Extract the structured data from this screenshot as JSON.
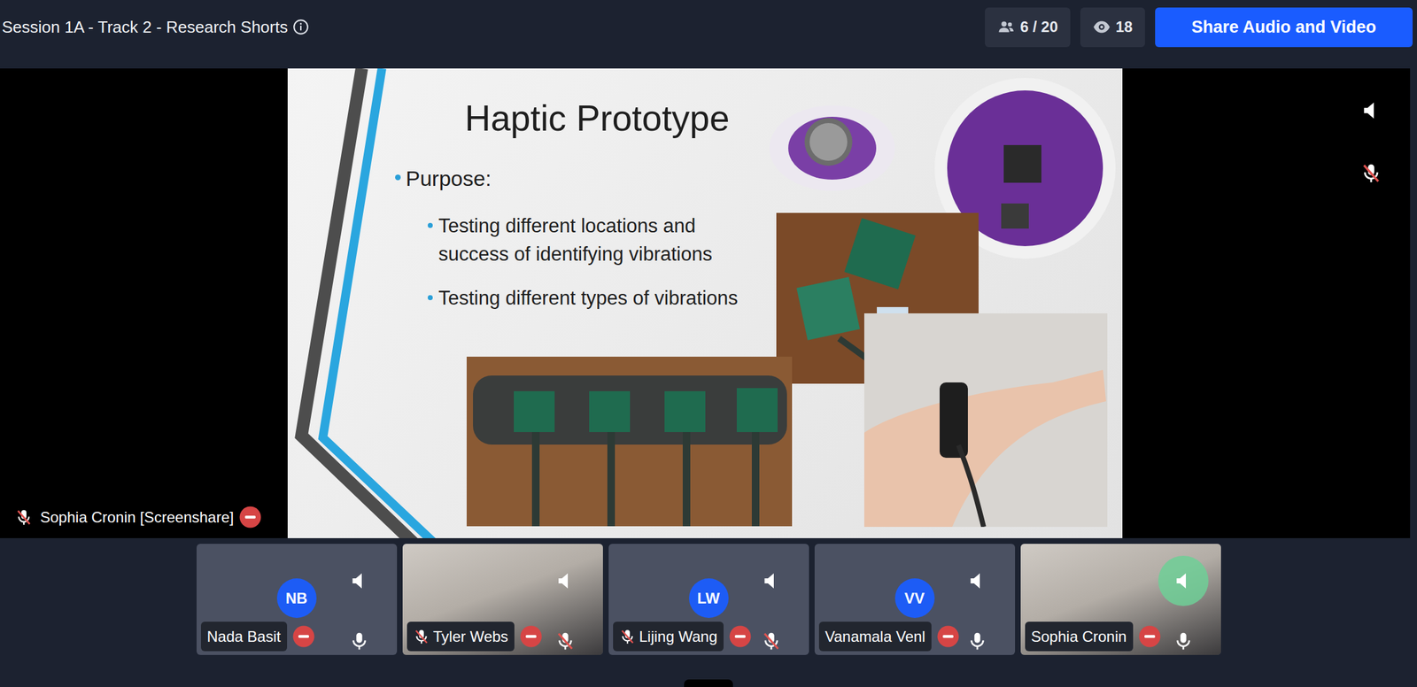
{
  "window": {
    "title": "Session 1A - Track 2 - Research Shorts"
  },
  "header": {
    "participants_count": "6 / 20",
    "viewer_count": "18",
    "share_button": "Share Audio and Video"
  },
  "stage": {
    "presenter_label": "Sophia Cronin [Screenshare]",
    "presenter_muted": true,
    "muted": true,
    "slide": {
      "title": "Haptic Prototype",
      "heading": "Purpose:",
      "bullets": [
        "Testing different locations and success of identifying vibrations",
        "Testing different types of vibrations"
      ]
    }
  },
  "participants": [
    {
      "name": "Nada Basit",
      "kind": "avatar",
      "initials": "NB",
      "muted": false,
      "speaking": false
    },
    {
      "name": "Tyler Webs",
      "kind": "video",
      "muted": true,
      "speaking": false
    },
    {
      "name": "Lijing Wang",
      "kind": "avatar",
      "initials": "LW",
      "muted": true,
      "speaking": false
    },
    {
      "name": "Vanamala Venl",
      "kind": "avatar",
      "initials": "VV",
      "muted": false,
      "speaking": false
    },
    {
      "name": "Sophia Cronin",
      "kind": "video",
      "muted": false,
      "speaking": true
    }
  ]
}
